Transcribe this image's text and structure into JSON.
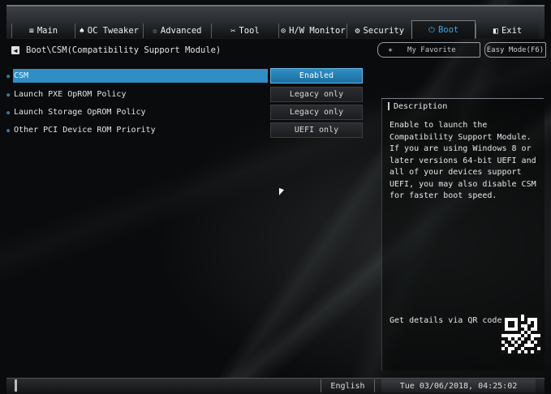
{
  "nav": {
    "tabs": [
      {
        "icon": "≡",
        "label": "Main",
        "active": false
      },
      {
        "icon": "♠",
        "label": "OC Tweaker",
        "active": false
      },
      {
        "icon": "☆",
        "label": "Advanced",
        "active": false
      },
      {
        "icon": "✂",
        "label": "Tool",
        "active": false
      },
      {
        "icon": "⊙",
        "label": "H/W Monitor",
        "active": false
      },
      {
        "icon": "⚙",
        "label": "Security",
        "active": false
      },
      {
        "icon": "⏻",
        "label": "Boot",
        "active": true
      },
      {
        "icon": "◧",
        "label": "Exit",
        "active": false
      }
    ]
  },
  "breadcrumb": {
    "path": "Boot\\CSM(Compatibility Support Module)"
  },
  "top_buttons": {
    "favorite": "My Favorite",
    "easy_mode": "Easy Mode(F6)"
  },
  "settings": [
    {
      "label": "CSM",
      "value": "Enabled",
      "selected": true
    },
    {
      "label": "Launch PXE OpROM Policy",
      "value": "Legacy only",
      "selected": false
    },
    {
      "label": "Launch Storage OpROM Policy",
      "value": "Legacy only",
      "selected": false
    },
    {
      "label": "Other PCI Device ROM Priority",
      "value": "UEFI only",
      "selected": false
    }
  ],
  "description": {
    "title": "Description",
    "text": "Enable to launch the Compatibility Support Module. If you are using Windows 8 or later versions 64-bit UEFI and all of your devices support UEFI, you may also disable CSM for faster boot speed.",
    "qr_label": "Get details via QR code"
  },
  "status": {
    "language": "English",
    "datetime": "Tue 03/06/2018, 04:25:02"
  },
  "colors": {
    "accent": "#2f8fc4",
    "accent_text": "#3aa8e6",
    "background": "#0a0b0c"
  }
}
